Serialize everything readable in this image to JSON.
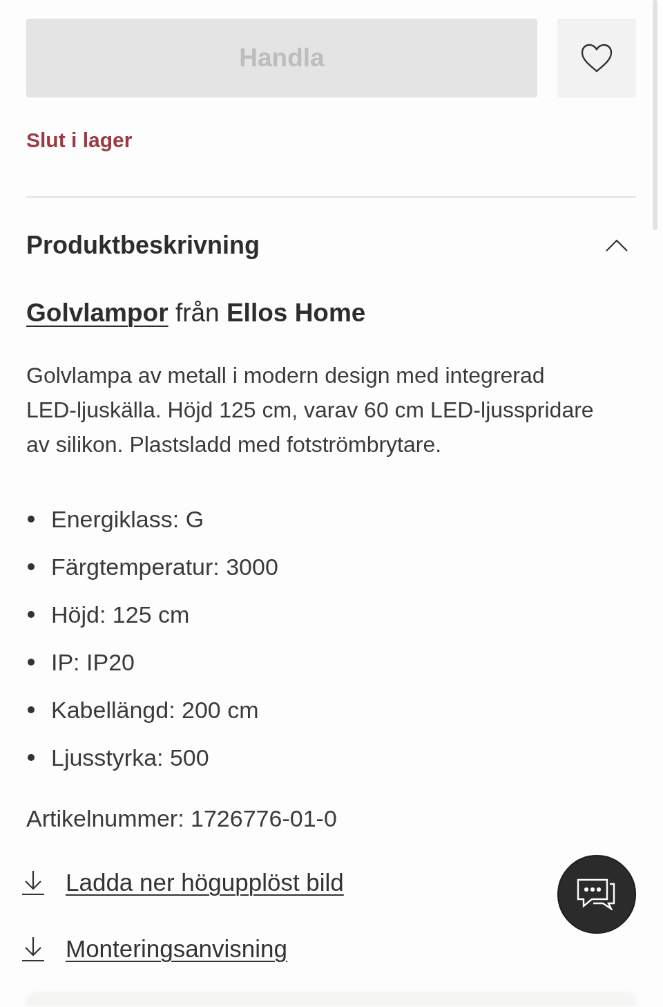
{
  "buy_button": {
    "label": "Handla",
    "disabled": true
  },
  "wishlist_button": {
    "favorited": false
  },
  "stock_status": "Slut i lager",
  "section": {
    "title": "Produktbeskrivning",
    "expanded": true,
    "origin": {
      "link": "Golvlampor",
      "text": "från **Ellos Home**"
    },
    "description": "Golvlampa av metall i modern design med integrerad LED-ljuskälla. Höjd 125 cm, varav 60 cm LED-ljusspridare av silikon. Plastsladd med fotströmbrytare.",
    "specs": [
      "Energiklass: G",
      "Färgtemperatur: 3000",
      "Höjd: 125 cm",
      "IP: IP20",
      "Kabellängd: 200 cm",
      "Ljusstyrka: 500"
    ],
    "article_number": "Artikelnummer: 1726776-01-0",
    "downloads": [
      {
        "label": "Ladda ner högupplöst bild"
      },
      {
        "label": "Monteringsanvisning"
      }
    ]
  }
}
